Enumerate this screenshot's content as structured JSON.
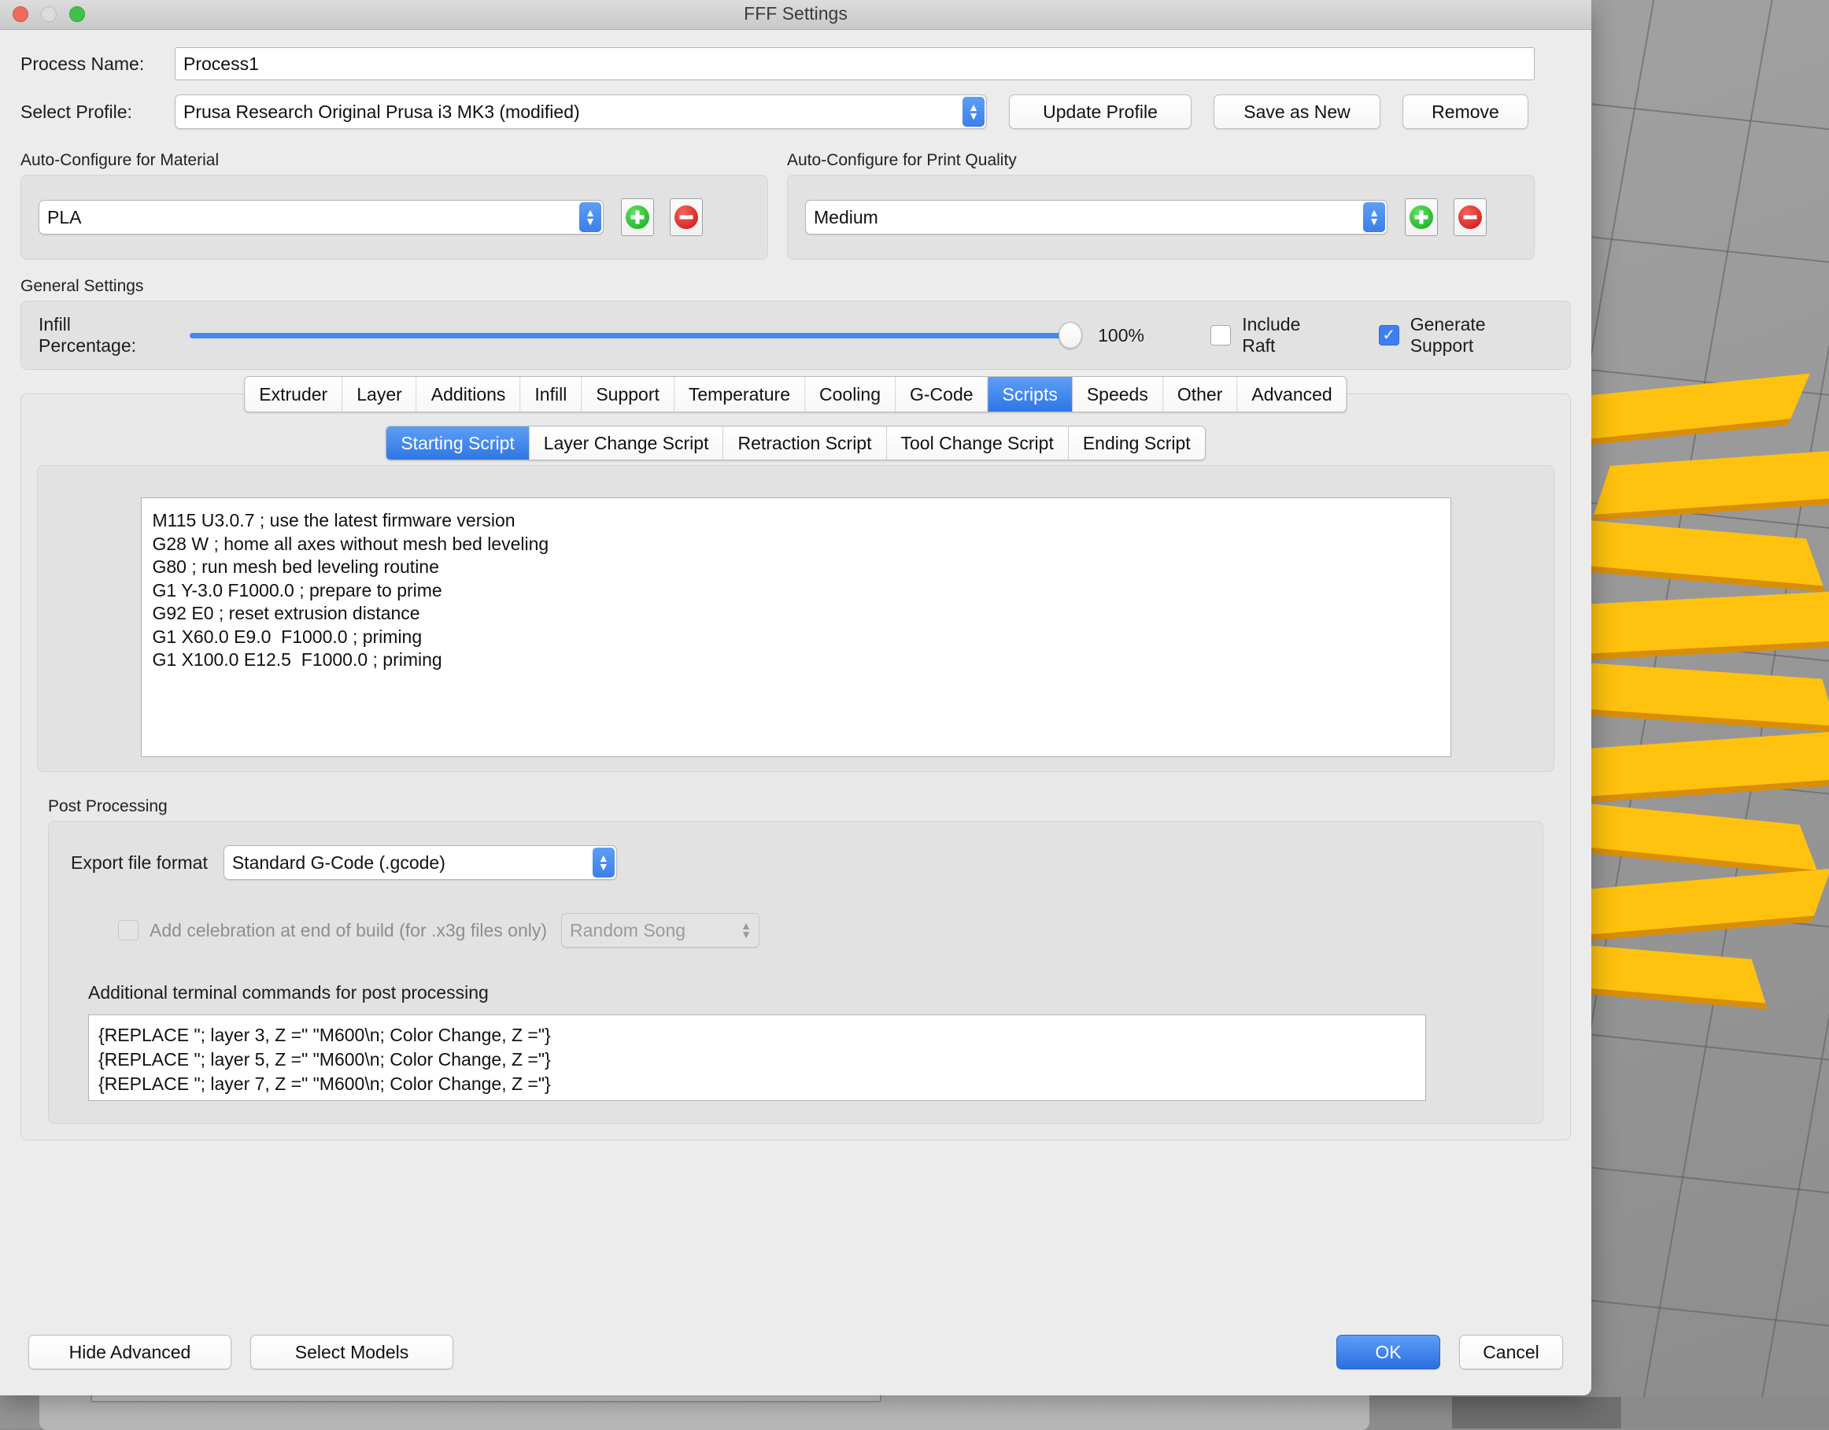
{
  "window": {
    "title": "FFF Settings",
    "traffic_lights": [
      "close-button",
      "minimize-button",
      "zoom-button"
    ]
  },
  "process": {
    "name_label": "Process Name:",
    "name_value": "Process1",
    "profile_label": "Select Profile:",
    "profile_value": "Prusa Research Original Prusa i3 MK3 (modified)",
    "update_label": "Update Profile",
    "save_as_new_label": "Save as New",
    "remove_label": "Remove"
  },
  "material": {
    "group_label": "Auto-Configure for Material",
    "value": "PLA",
    "add_label": "+",
    "remove_label": "−"
  },
  "quality": {
    "group_label": "Auto-Configure for Print Quality",
    "value": "Medium",
    "add_label": "+",
    "remove_label": "−"
  },
  "general": {
    "group_label": "General Settings",
    "infill_label": "Infill Percentage:",
    "infill_value": "100%",
    "infill_percent": 100,
    "include_raft_label": "Include Raft",
    "include_raft_checked": false,
    "generate_support_label": "Generate Support",
    "generate_support_checked": true,
    "check_glyph": "✓"
  },
  "main_tabs": [
    {
      "label": "Extruder",
      "active": false
    },
    {
      "label": "Layer",
      "active": false
    },
    {
      "label": "Additions",
      "active": false
    },
    {
      "label": "Infill",
      "active": false
    },
    {
      "label": "Support",
      "active": false
    },
    {
      "label": "Temperature",
      "active": false
    },
    {
      "label": "Cooling",
      "active": false
    },
    {
      "label": "G-Code",
      "active": false
    },
    {
      "label": "Scripts",
      "active": true
    },
    {
      "label": "Speeds",
      "active": false
    },
    {
      "label": "Other",
      "active": false
    },
    {
      "label": "Advanced",
      "active": false
    }
  ],
  "sub_tabs": [
    {
      "label": "Starting Script",
      "active": true
    },
    {
      "label": "Layer Change Script",
      "active": false
    },
    {
      "label": "Retraction Script",
      "active": false
    },
    {
      "label": "Tool Change Script",
      "active": false
    },
    {
      "label": "Ending Script",
      "active": false
    }
  ],
  "script": {
    "text": "M115 U3.0.7 ; use the latest firmware version\nG28 W ; home all axes without mesh bed leveling\nG80 ; run mesh bed leveling routine\nG1 Y-3.0 F1000.0 ; prepare to prime\nG92 E0 ; reset extrusion distance\nG1 X60.0 E9.0  F1000.0 ; priming\nG1 X100.0 E12.5  F1000.0 ; priming"
  },
  "post_processing": {
    "group_label": "Post Processing",
    "export_label": "Export file format",
    "export_value": "Standard G-Code (.gcode)",
    "celebration_label": "Add celebration at end of build (for .x3g files only)",
    "celebration_checked": false,
    "celebration_song": "Random Song",
    "terminal_label": "Additional terminal commands for post processing",
    "terminal_text": "{REPLACE \"; layer 3, Z =\" \"M600\\n; Color Change, Z =\"}\n{REPLACE \"; layer 5, Z =\" \"M600\\n; Color Change, Z =\"}\n{REPLACE \"; layer 7, Z =\" \"M600\\n; Color Change, Z =\"}"
  },
  "footer": {
    "hide_advanced_label": "Hide Advanced",
    "select_models_label": "Select Models",
    "ok_label": "OK",
    "cancel_label": "Cancel"
  },
  "colors": {
    "accent_blue": "#3d7ff0",
    "model_yellow": "#FFC20E",
    "model_shadow": "#D98E0B",
    "add_green": "#14a81c",
    "remove_red": "#cc1111"
  }
}
